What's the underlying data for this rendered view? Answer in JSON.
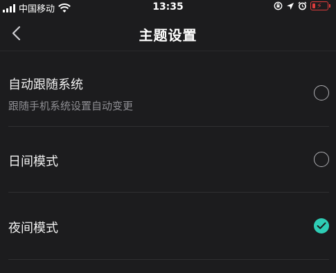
{
  "status_bar": {
    "carrier": "中国移动",
    "time": "13:35",
    "battery_color": "#e03c3c"
  },
  "nav": {
    "back_icon": "chevron-left-icon",
    "title": "主题设置"
  },
  "options": [
    {
      "title": "自动跟随系统",
      "subtitle": "跟随手机系统设置自动变更",
      "selected": false
    },
    {
      "title": "日间模式",
      "selected": false
    },
    {
      "title": "夜间模式",
      "selected": true
    }
  ],
  "accent_color": "#2ecdb5"
}
